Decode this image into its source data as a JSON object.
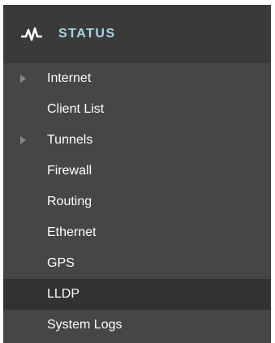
{
  "header": {
    "title": "STATUS",
    "icon": "pulse-icon",
    "accent_color": "#a9d7e6"
  },
  "menu": {
    "items": [
      {
        "label": "Internet",
        "expandable": true,
        "active": false
      },
      {
        "label": "Client List",
        "expandable": false,
        "active": false
      },
      {
        "label": "Tunnels",
        "expandable": true,
        "active": false
      },
      {
        "label": "Firewall",
        "expandable": false,
        "active": false
      },
      {
        "label": "Routing",
        "expandable": false,
        "active": false
      },
      {
        "label": "Ethernet",
        "expandable": false,
        "active": false
      },
      {
        "label": "GPS",
        "expandable": false,
        "active": false
      },
      {
        "label": "LLDP",
        "expandable": false,
        "active": true
      },
      {
        "label": "System Logs",
        "expandable": false,
        "active": false
      }
    ]
  }
}
